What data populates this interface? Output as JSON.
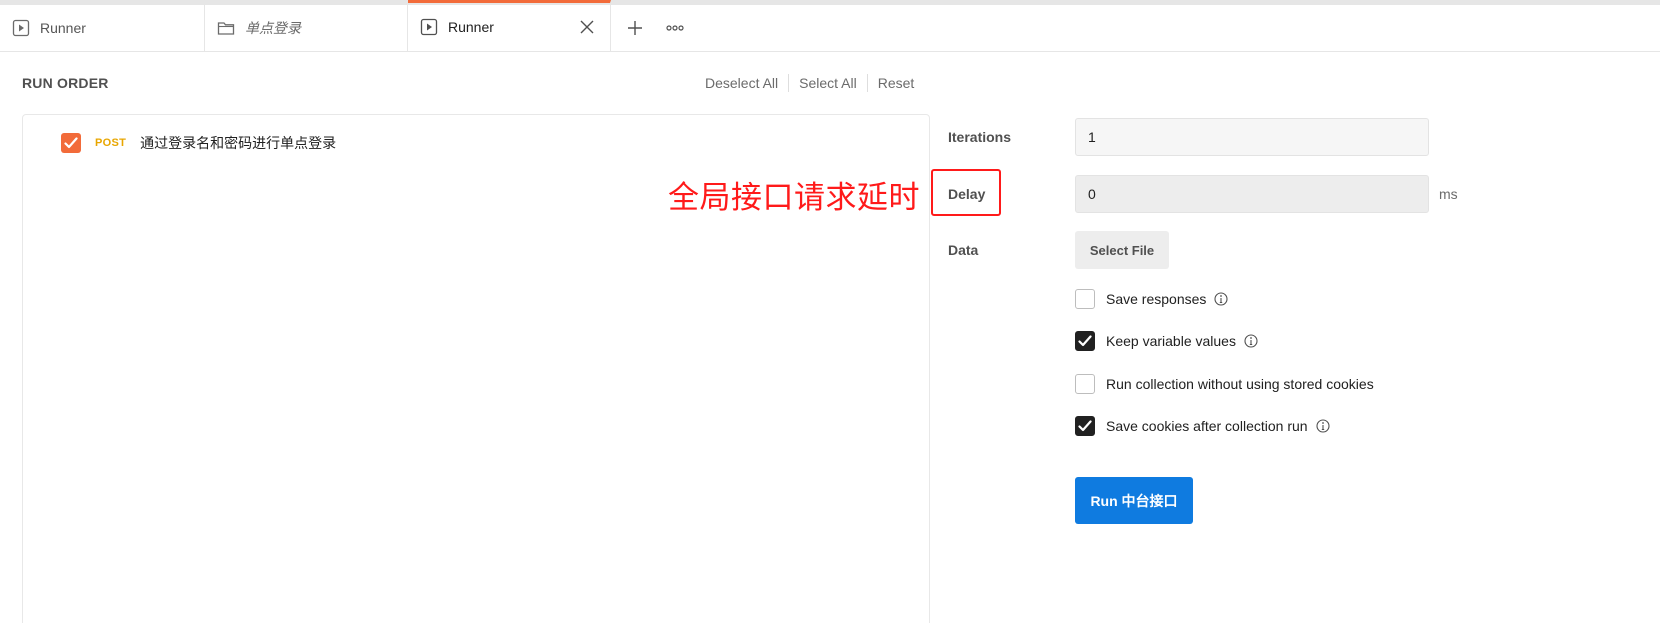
{
  "tabs": [
    {
      "label": "Runner",
      "icon": "runner-icon"
    },
    {
      "label": "单点登录",
      "icon": "folder-icon"
    },
    {
      "label": "Runner",
      "icon": "runner-icon",
      "active": true
    }
  ],
  "run_order": {
    "title": "RUN ORDER",
    "deselect_all": "Deselect All",
    "select_all": "Select All",
    "reset": "Reset",
    "requests": [
      {
        "method": "POST",
        "name": "通过登录名和密码进行单点登录",
        "checked": true
      }
    ]
  },
  "annotation": {
    "text": "全局接口请求延时",
    "color": "#ff1a1a"
  },
  "settings": {
    "iterations_label": "Iterations",
    "iterations_value": "1",
    "delay_label": "Delay",
    "delay_value": "0",
    "delay_unit": "ms",
    "data_label": "Data",
    "select_file_label": "Select File",
    "options": [
      {
        "label": "Save responses",
        "checked": false,
        "info": true
      },
      {
        "label": "Keep variable values",
        "checked": true,
        "info": true
      },
      {
        "label": "Run collection without using stored cookies",
        "checked": false,
        "info": false
      },
      {
        "label": "Save cookies after collection run",
        "checked": true,
        "info": true
      }
    ],
    "run_button": "Run 中台接口"
  },
  "colors": {
    "accent_orange": "#f26b3a",
    "method_post": "#e8a600",
    "run_button": "#0f7be0"
  }
}
